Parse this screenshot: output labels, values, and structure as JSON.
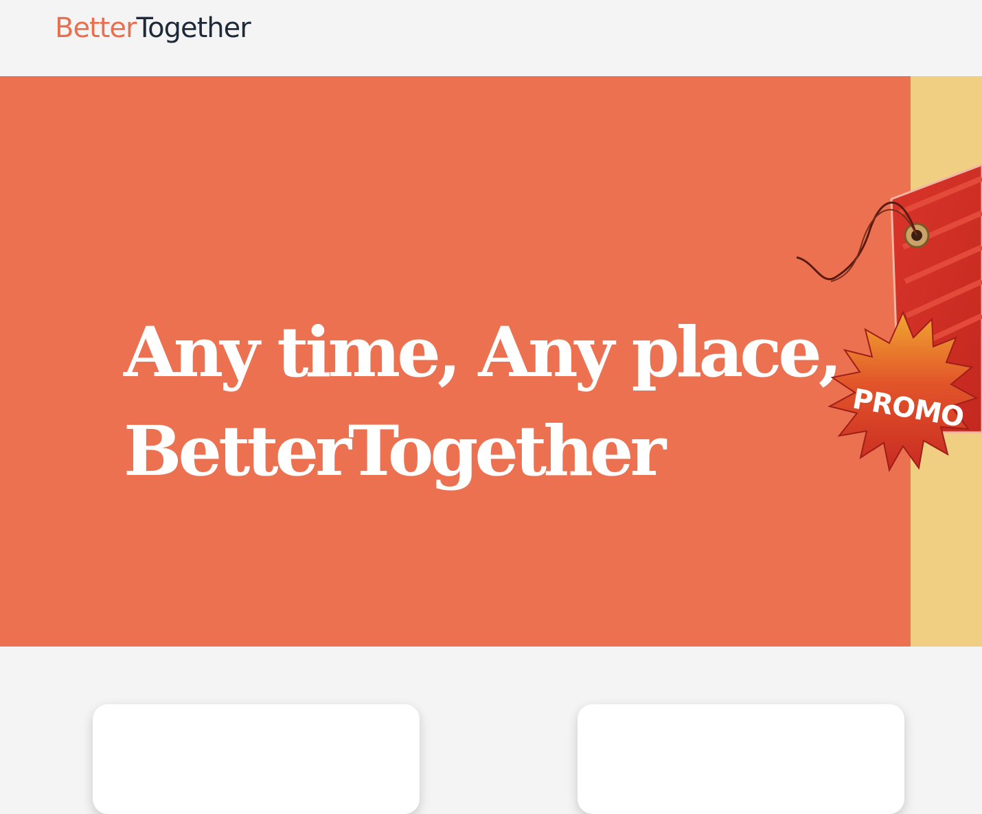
{
  "brand": {
    "logo_part1": "Better",
    "logo_part2": "Together",
    "logo_part1_color": "#e9704e",
    "logo_part2_color": "#1e2a3a"
  },
  "hero": {
    "headline_line1": "Any time, Any place,",
    "headline_line2": "BetterTogether",
    "background_color": "#ec7151",
    "side_panel_color": "#f1cf82",
    "promo_label": "PROMO",
    "promo_icon": "promo-tag-icon"
  },
  "cards": [
    {
      "name": "card-1"
    },
    {
      "name": "card-2"
    }
  ]
}
